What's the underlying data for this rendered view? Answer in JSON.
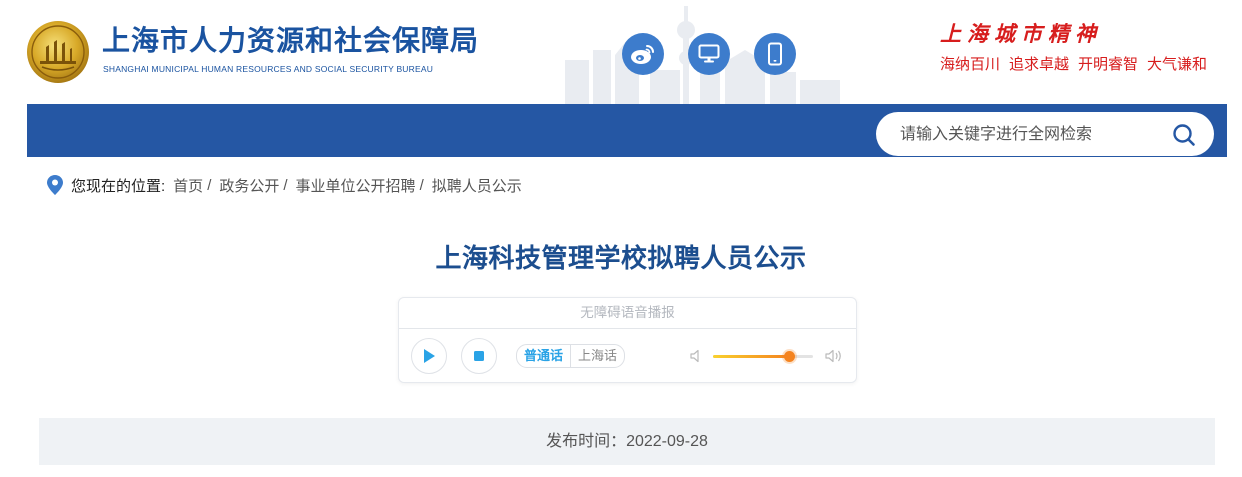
{
  "header": {
    "org_name_cn": "上海市人力资源和社会保障局",
    "org_name_en": "SHANGHAI MUNICIPAL HUMAN RESOURCES AND SOCIAL SECURITY BUREAU",
    "icons": [
      "weibo-icon",
      "desktop-icon",
      "mobile-icon"
    ],
    "spirit_title": "上海城市精神",
    "spirit_phrases": [
      "海纳百川",
      "追求卓越",
      "开明睿智",
      "大气谦和"
    ]
  },
  "nav": {
    "search_placeholder": "请输入关键字进行全网检索"
  },
  "breadcrumb": {
    "label": "您现在的位置:",
    "items": [
      "首页",
      "政务公开",
      "事业单位公开招聘",
      "拟聘人员公示"
    ],
    "separator": "/"
  },
  "article": {
    "title": "上海科技管理学校拟聘人员公示",
    "publish_label": "发布时间：",
    "publish_date": "2022-09-28"
  },
  "player": {
    "title": "无障碍语音播报",
    "languages": [
      "普通话",
      "上海话"
    ],
    "active_language": "普通话",
    "volume": 0.76
  },
  "colors": {
    "brand_blue": "#2557a4",
    "title_blue": "#1c4e8f",
    "spirit_red": "#d71d1d",
    "accent_cyan": "#2aa3e6",
    "volume_orange": "#f4831f"
  }
}
